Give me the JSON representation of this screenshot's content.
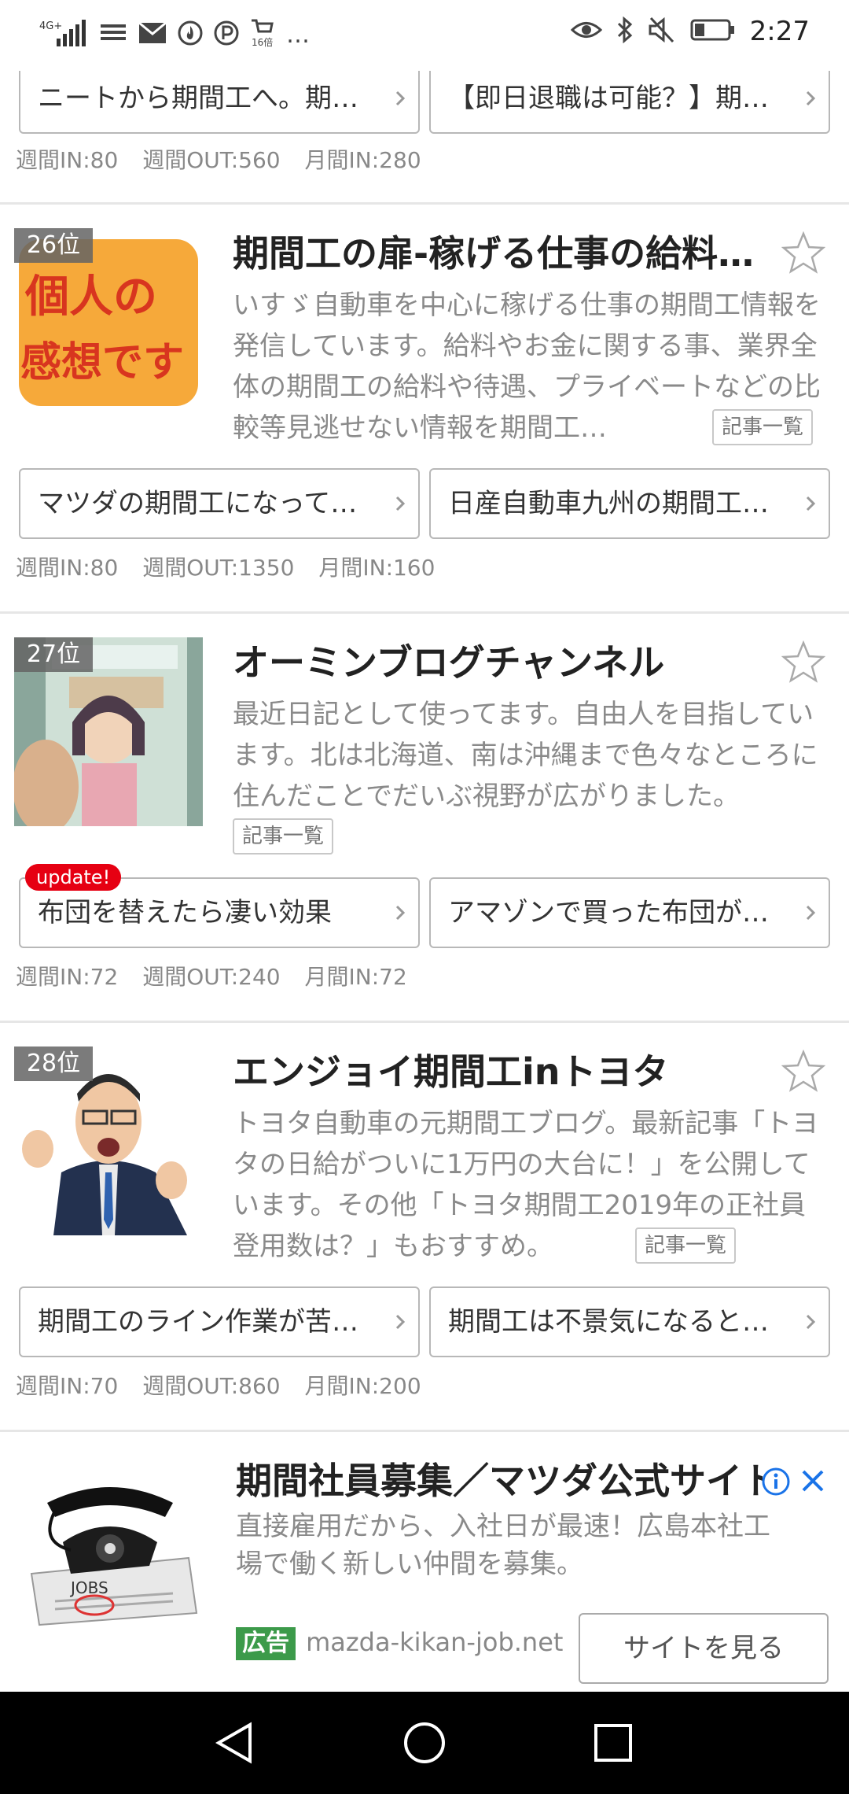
{
  "status": {
    "network": "4G+",
    "cart_badge": "16倍",
    "more": "…",
    "time": "2:27"
  },
  "prev_entry": {
    "articles": [
      "ニートから期間工へ。期…",
      "【即日退職は可能？】期…"
    ],
    "stats": [
      "週間IN:80",
      "週間OUT:560",
      "月間IN:280"
    ]
  },
  "entries": [
    {
      "rank": "26位",
      "title": "期間工の扉-稼げる仕事の給料…",
      "description": "いすゞ自動車を中心に稼げる仕事の期間工情報を発信しています。給料やお金に関する事、業界全体の期間工の給料や待遇、プライベートなどの比較等見逃せない情報を期間工…",
      "list_label": "記事一覧",
      "thumb_text_1": "個人の",
      "thumb_text_2": "感想です",
      "articles": [
        "マツダの期間工になって…",
        "日産自動車九州の期間工…"
      ],
      "stats": [
        "週間IN:80",
        "週間OUT:1350",
        "月間IN:160"
      ]
    },
    {
      "rank": "27位",
      "title": "オーミンブログチャンネル",
      "description": "最近日記として使ってます。自由人を目指しています。北は北海道、南は沖縄まで色々なところに住んだことでだいぶ視野が広がりました。",
      "list_label": "記事一覧",
      "update_badge": "update!",
      "articles": [
        "布団を替えたら凄い効果",
        "アマゾンで買った布団が…"
      ],
      "stats": [
        "週間IN:72",
        "週間OUT:240",
        "月間IN:72"
      ]
    },
    {
      "rank": "28位",
      "title": "エンジョイ期間工inトヨタ",
      "description": "トヨタ自動車の元期間工ブログ。最新記事「トヨタの日給がついに1万円の大台に！」を公開しています。その他「トヨタ期間工2019年の正社員登用数は？」もおすすめ。",
      "list_label": "記事一覧",
      "articles": [
        "期間工のライン作業が苦…",
        "期間工は不景気になると…"
      ],
      "stats": [
        "週間IN:70",
        "週間OUT:860",
        "月間IN:200"
      ]
    }
  ],
  "ad": {
    "title": "期間社員募集／マツダ公式サイト",
    "description": "直接雇用だから、入社日が最速！広島本社工場で働く新しい仲間を募集。",
    "tag": "広告",
    "url": "mazda-kikan-job.net",
    "cta": "サイトを見る",
    "newspaper_text": "JOBS"
  },
  "colors": {
    "accent_red": "#e60012",
    "ad_green": "#3c9a4a",
    "info_blue": "#1a73e8"
  },
  "icons": [
    "signal-icon",
    "wifi-icon",
    "mail-icon",
    "fire-icon",
    "p-icon",
    "cart-icon",
    "eye-icon",
    "bluetooth-icon",
    "mute-icon",
    "battery-icon",
    "star-icon",
    "chevron-right-icon",
    "info-icon",
    "close-icon",
    "back-icon",
    "home-icon",
    "recents-icon"
  ]
}
